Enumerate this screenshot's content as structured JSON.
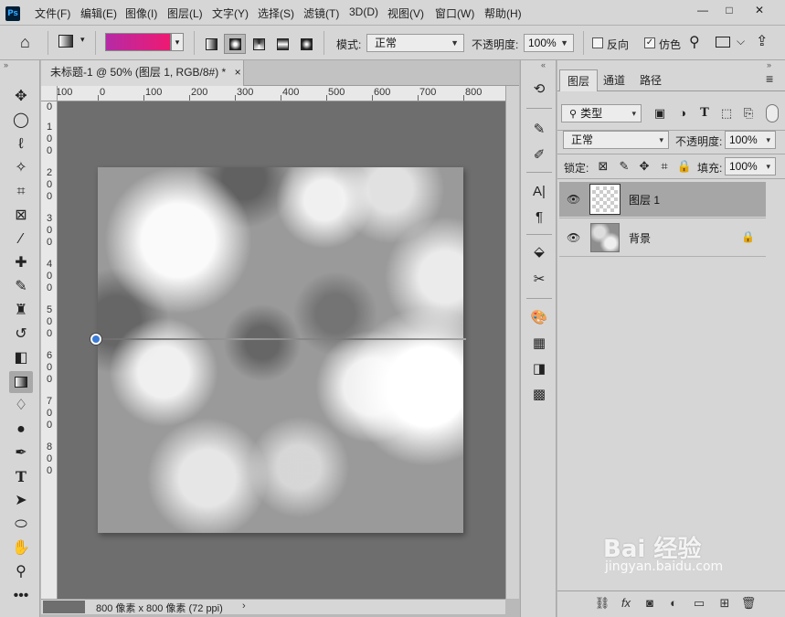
{
  "app": {
    "logo": "Ps",
    "menu": [
      "文件(F)",
      "编辑(E)",
      "图像(I)",
      "图层(L)",
      "文字(Y)",
      "选择(S)",
      "滤镜(T)",
      "3D(D)",
      "视图(V)",
      "窗口(W)",
      "帮助(H)"
    ],
    "window_controls": [
      "—",
      "□",
      "✕"
    ]
  },
  "options": {
    "mode_label": "模式:",
    "mode_value": "正常",
    "opacity_label": "不透明度:",
    "opacity_value": "100%",
    "reverse_label": "反向",
    "reverse_checked": false,
    "dither_label": "仿色",
    "dither_checked": true,
    "gradient_colors": [
      "#b62aa6",
      "#ee1a72"
    ],
    "selected_gradient_type": "radial"
  },
  "document": {
    "tab_title": "未标题-1 @ 50% (图层 1, RGB/8#) *",
    "tab_close": "×",
    "ruler_h_labels": [
      "100",
      "0",
      "100",
      "200",
      "300",
      "400",
      "500",
      "600",
      "700",
      "800"
    ],
    "ruler_v_labels": [
      "0",
      "100",
      "200",
      "300",
      "400",
      "500",
      "600",
      "700",
      "800"
    ],
    "status_info": "800 像素 x 800 像素 (72 ppi)",
    "status_arrow": "›"
  },
  "layers_panel": {
    "tabs": [
      "图层",
      "通道",
      "路径"
    ],
    "filter_kind": "类型",
    "blend_mode": "正常",
    "opacity_label": "不透明度:",
    "opacity_value": "100%",
    "lock_label": "锁定:",
    "fill_label": "填充:",
    "fill_value": "100%",
    "layers": [
      {
        "name": "图层 1",
        "selected": true,
        "visible": true,
        "locked": false
      },
      {
        "name": "背景",
        "selected": false,
        "visible": true,
        "locked": true
      }
    ]
  },
  "watermark": {
    "text": "Bai 经验",
    "url": "jingyan.baidu.com"
  }
}
